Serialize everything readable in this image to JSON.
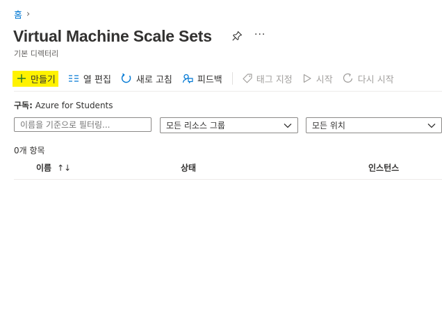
{
  "breadcrumb": {
    "home": "홈",
    "separator": "›"
  },
  "page": {
    "title": "Virtual Machine Scale Sets",
    "subtitle": "기본 디렉터리",
    "more": "···"
  },
  "toolbar": {
    "create": "만들기",
    "edit_columns": "열 편집",
    "refresh": "새로 고침",
    "feedback": "피드백",
    "assign_tags": "태그 지정",
    "start": "시작",
    "restart": "다시 시작"
  },
  "subscription": {
    "label": "구독:",
    "value": "Azure for Students"
  },
  "filters": {
    "search_placeholder": "이름을 기준으로 필터링...",
    "resource_group": "모든 리소스 그룹",
    "location": "모든 위치"
  },
  "list": {
    "count": "0개 항목",
    "columns": [
      "이름",
      "상태",
      "인스턴스"
    ],
    "sort_indicator": "↑↓"
  },
  "colors": {
    "accent": "#0078d4",
    "highlight": "#fff200",
    "disabled": "#a19f9d"
  }
}
